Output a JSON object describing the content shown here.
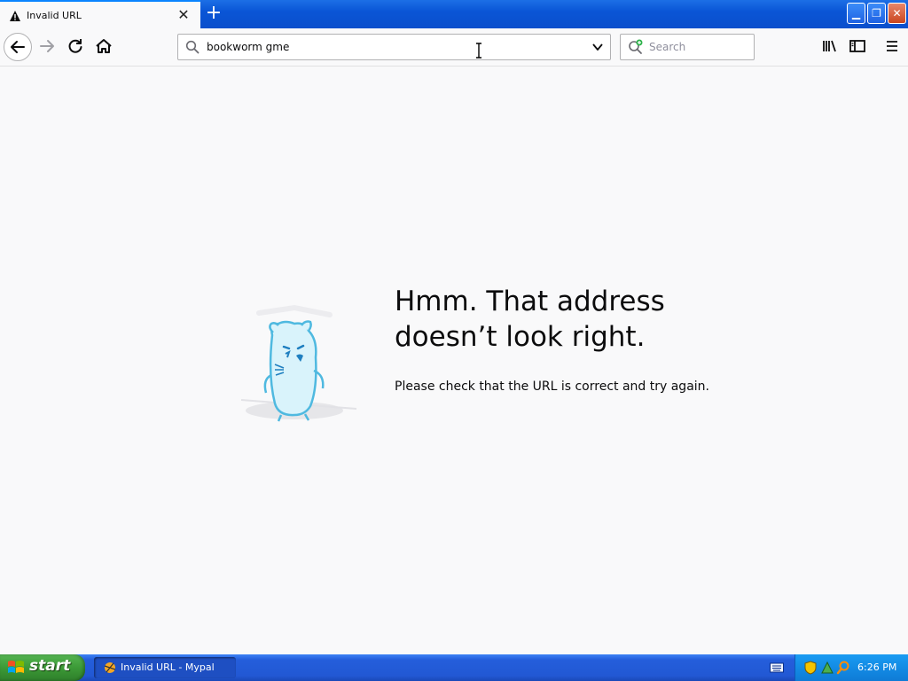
{
  "browser": {
    "tab": {
      "title": "Invalid URL",
      "close_glyph": "✕"
    },
    "new_tab_glyph": "+",
    "window_controls": {
      "minimize": "▁",
      "maximize": "❐",
      "close": "✕"
    },
    "url_bar": {
      "value": "bookworm gme"
    },
    "search_bar": {
      "placeholder": "Search"
    },
    "icons": [
      "warning-icon",
      "back-arrow-icon",
      "forward-arrow-icon",
      "reload-icon",
      "home-icon",
      "search-icon",
      "dropdown-chevron-icon",
      "search-engine-icon",
      "library-icon",
      "sidebar-icon",
      "hamburger-menu-icon"
    ]
  },
  "error_page": {
    "title": "Hmm. That address doesn’t look right.",
    "description": "Please check that the URL is correct and try again."
  },
  "taskbar": {
    "start_label": "start",
    "task_button_label": "Invalid URL - Mypal",
    "clock": "6:26 PM"
  },
  "colors": {
    "accent": "#0a84ff",
    "taskbar_blue": "#245edb",
    "start_green": "#3c9a37",
    "page_bg": "#f9f9fa"
  }
}
